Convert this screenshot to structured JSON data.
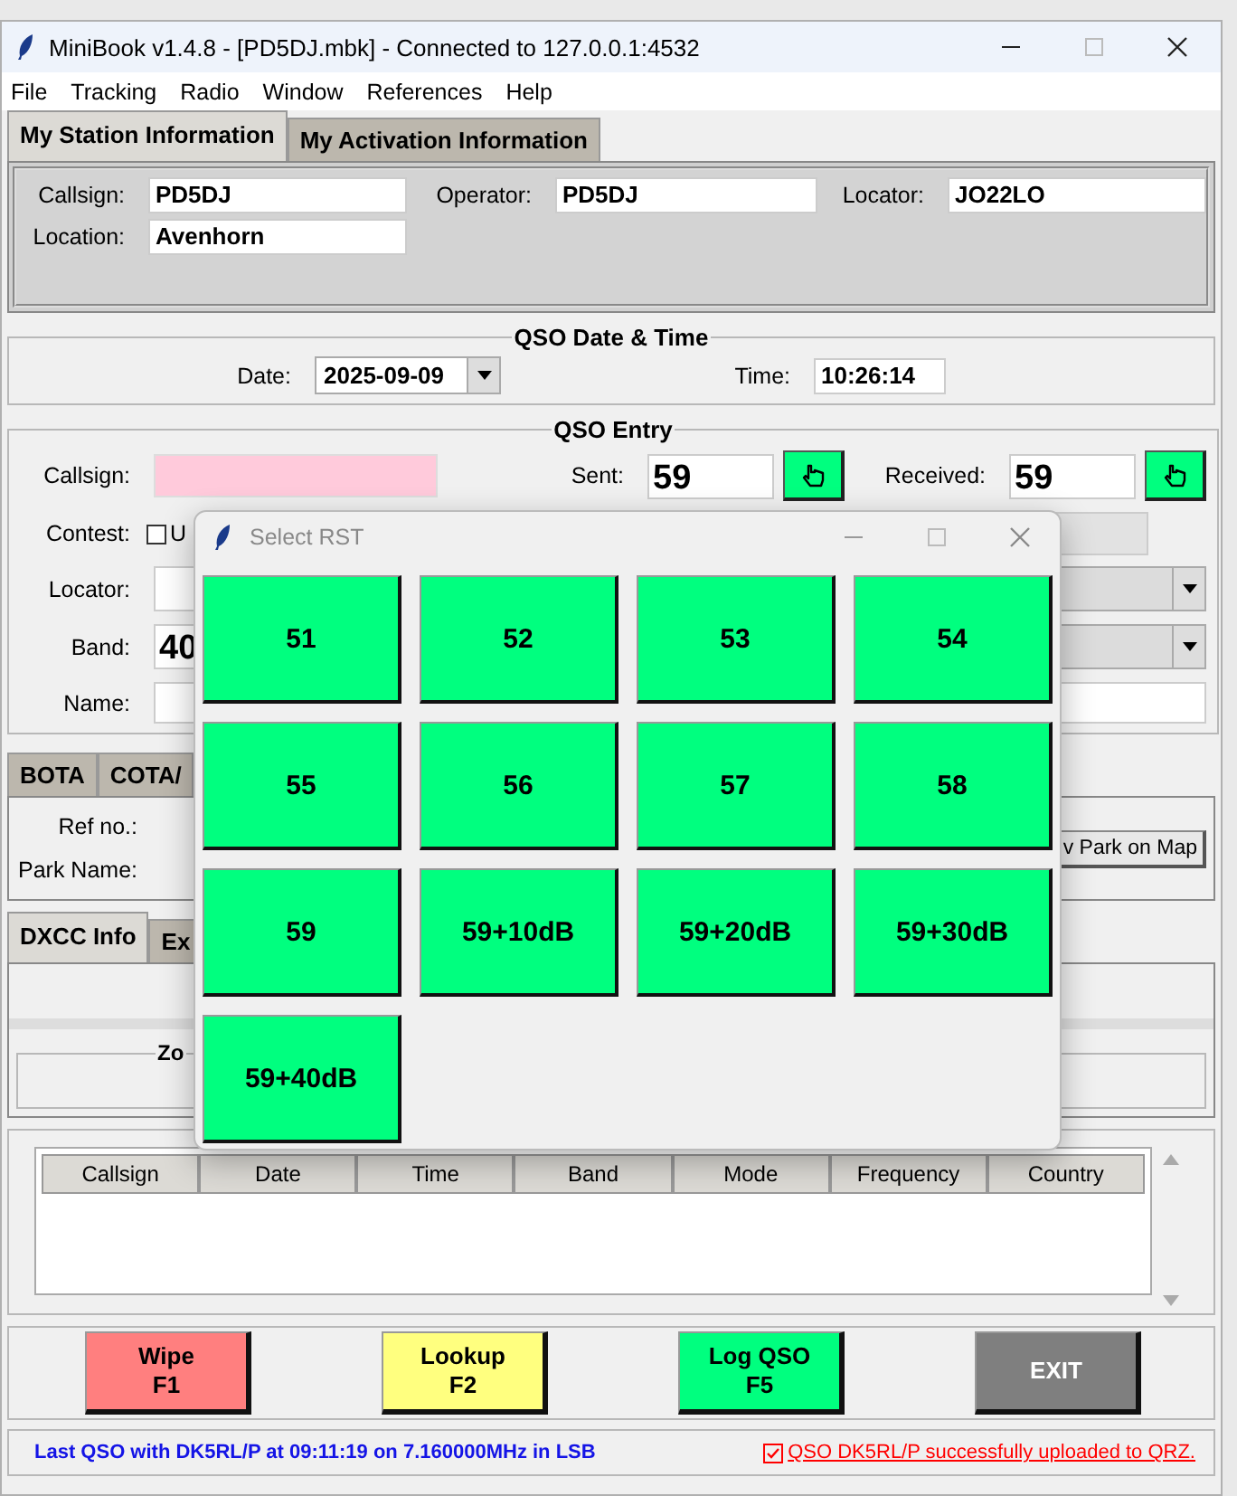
{
  "window": {
    "title": "MiniBook v1.4.8 - [PD5DJ.mbk] - Connected to 127.0.0.1:4532"
  },
  "menu": [
    "File",
    "Tracking",
    "Radio",
    "Window",
    "References",
    "Help"
  ],
  "station_tabs": [
    {
      "label": "My Station Information",
      "selected": true
    },
    {
      "label": "My Activation Information",
      "selected": false
    }
  ],
  "station": {
    "callsign_label": "Callsign:",
    "callsign": "PD5DJ",
    "operator_label": "Operator:",
    "operator": "PD5DJ",
    "locator_label": "Locator:",
    "locator": "JO22LO",
    "location_label": "Location:",
    "location": "Avenhorn"
  },
  "datetime": {
    "title": "QSO Date & Time",
    "date_label": "Date:",
    "date": "2025-09-09",
    "time_label": "Time:",
    "time": "10:26:14"
  },
  "entry": {
    "title": "QSO Entry",
    "callsign_label": "Callsign:",
    "sent_label": "Sent:",
    "sent": "59",
    "received_label": "Received:",
    "received": "59",
    "contest_label": "Contest:",
    "contest_checked": false,
    "contest_option": "U",
    "locator_label": "Locator:",
    "band_label": "Band:",
    "band": "40",
    "name_label": "Name:"
  },
  "reference_tabs": [
    {
      "label": "BOTA",
      "selected": false
    },
    {
      "label": "COTA/",
      "selected": false
    }
  ],
  "reference": {
    "ref_label": "Ref no.:",
    "park_label": "Park Name:",
    "map_button": "v Park on Map"
  },
  "info_tabs": [
    {
      "label": "DXCC Info",
      "selected": true
    },
    {
      "label": "Ex",
      "selected": false
    }
  ],
  "zone_frame": {
    "title": "Zo"
  },
  "log_table": {
    "columns": [
      "Callsign",
      "Date",
      "Time",
      "Band",
      "Mode",
      "Frequency",
      "Country"
    ]
  },
  "actions": [
    {
      "label": "Wipe",
      "key": "F1",
      "kind": "normal",
      "color": "#ff7f7f"
    },
    {
      "label": "Lookup",
      "key": "F2",
      "kind": "normal",
      "color": "#ffff7f"
    },
    {
      "label": "Log QSO",
      "key": "F5",
      "kind": "normal",
      "color": "#00ff7f"
    },
    {
      "label": "EXIT",
      "kind": "exit",
      "color": "#7f7f7f"
    }
  ],
  "status": {
    "last_qso": "Last QSO with DK5RL/P at 09:11:19 on 7.160000MHz in LSB",
    "upload": "QSO DK5RL/P successfully uploaded to QRZ.",
    "upload_ok": true
  },
  "dialog": {
    "title": "Select RST",
    "options": [
      "51",
      "52",
      "53",
      "54",
      "55",
      "56",
      "57",
      "58",
      "59",
      "59+10dB",
      "59+20dB",
      "59+30dB",
      "59+40dB"
    ]
  }
}
